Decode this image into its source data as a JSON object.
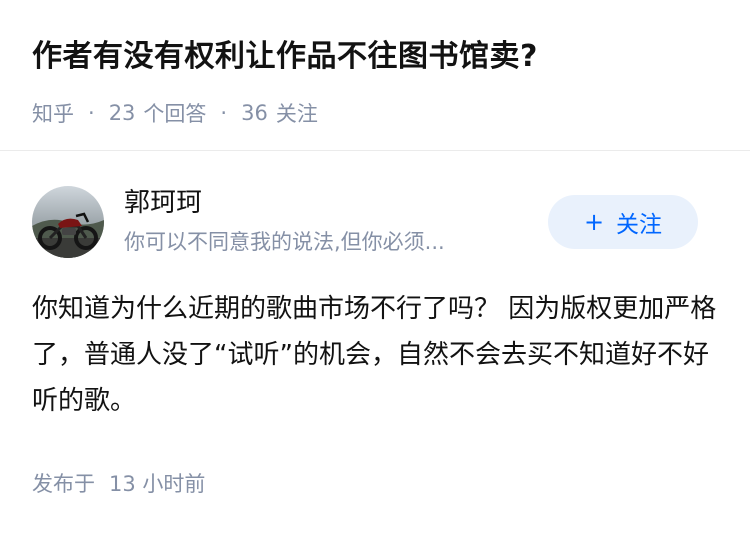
{
  "question": {
    "title": "作者有没有权利让作品不往图书馆卖?",
    "source": "知乎",
    "answers_count": "23",
    "answers_label": "个回答",
    "followers_count": "36",
    "followers_label": "关注",
    "separator": "·"
  },
  "author": {
    "name": "郭珂珂",
    "bio": "你可以不同意我的说法,但你必须...",
    "avatar_icon": "avatar-motorcycle-photo"
  },
  "follow_button": {
    "icon": "+",
    "label": "关注"
  },
  "answer": {
    "content": "你知道为什么近期的歌曲市场不行了吗？ 因为版权更加严格了，普通人没了“试听”的机会，自然不会去买不知道好不好听的歌。"
  },
  "footer": {
    "published_label": "发布于",
    "published_time": "13 小时前"
  },
  "colors": {
    "accent": "#0066ff",
    "accent_bg": "#e9f1fc",
    "meta_text": "#8590a6",
    "main_text": "#121212"
  }
}
